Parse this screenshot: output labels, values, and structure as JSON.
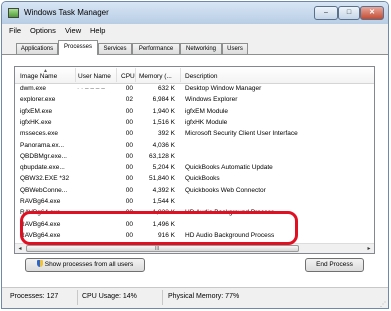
{
  "window": {
    "title": "Windows Task Manager",
    "icon": "task-manager-icon"
  },
  "title_buttons": {
    "minimize": "–",
    "maximize": "□",
    "close": "✕"
  },
  "menu": [
    "File",
    "Options",
    "View",
    "Help"
  ],
  "tabs": [
    {
      "label": "Applications",
      "active": false
    },
    {
      "label": "Processes",
      "active": true
    },
    {
      "label": "Services",
      "active": false
    },
    {
      "label": "Performance",
      "active": false
    },
    {
      "label": "Networking",
      "active": false
    },
    {
      "label": "Users",
      "active": false
    }
  ],
  "columns": {
    "name": "Image Name",
    "user": "User Name",
    "cpu": "CPU",
    "memory": "Memory (...",
    "description": "Description"
  },
  "rows": [
    {
      "name": "dwm.exe",
      "user": "· · ‒ ‒ ‒ ‒",
      "cpu": "00",
      "memory": "632 K",
      "description": "Desktop Window Manager"
    },
    {
      "name": "explorer.exe",
      "user": "",
      "cpu": "02",
      "memory": "6,984 K",
      "description": "Windows Explorer"
    },
    {
      "name": "igfxEM.exe",
      "user": "",
      "cpu": "00",
      "memory": "1,940 K",
      "description": "igfxEM Module"
    },
    {
      "name": "igfxHK.exe",
      "user": "",
      "cpu": "00",
      "memory": "1,516 K",
      "description": "igfxHK Module"
    },
    {
      "name": "msseces.exe",
      "user": "",
      "cpu": "00",
      "memory": "392 K",
      "description": "Microsoft Security Client User Interface"
    },
    {
      "name": "Panorama.ex...",
      "user": "",
      "cpu": "00",
      "memory": "4,036 K",
      "description": ""
    },
    {
      "name": "QBDBMgr.exe...",
      "user": "",
      "cpu": "00",
      "memory": "63,128 K",
      "description": ""
    },
    {
      "name": "qbupdate.exe...",
      "user": "",
      "cpu": "00",
      "memory": "5,204 K",
      "description": "QuickBooks Automatic Update"
    },
    {
      "name": "QBW32.EXE *32",
      "user": "",
      "cpu": "00",
      "memory": "51,840 K",
      "description": "QuickBooks"
    },
    {
      "name": "QBWebConne...",
      "user": "",
      "cpu": "00",
      "memory": "4,392 K",
      "description": "Quickbooks Web Connector"
    },
    {
      "name": "RAVBg64.exe",
      "user": "",
      "cpu": "00",
      "memory": "1,544 K",
      "description": ""
    },
    {
      "name": "RAVBg64.exe",
      "user": "",
      "cpu": "00",
      "memory": "1,828 K",
      "description": "HD Audio Background Process"
    },
    {
      "name": "RAVBg64.exe",
      "user": "",
      "cpu": "00",
      "memory": "1,496 K",
      "description": ""
    },
    {
      "name": "RAVBg64.exe",
      "user": "",
      "cpu": "00",
      "memory": "916 K",
      "description": "HD Audio Background Process"
    }
  ],
  "scrollbar": {
    "left_arrow": "◂",
    "right_arrow": "▸",
    "grip": "III"
  },
  "buttons": {
    "show_all": "Show processes from all users",
    "end_process": "End Process"
  },
  "status": {
    "processes": "Processes: 127",
    "cpu": "CPU Usage: 14%",
    "memory": "Physical Memory: 77%"
  },
  "colors": {
    "highlight": "#e01022"
  }
}
